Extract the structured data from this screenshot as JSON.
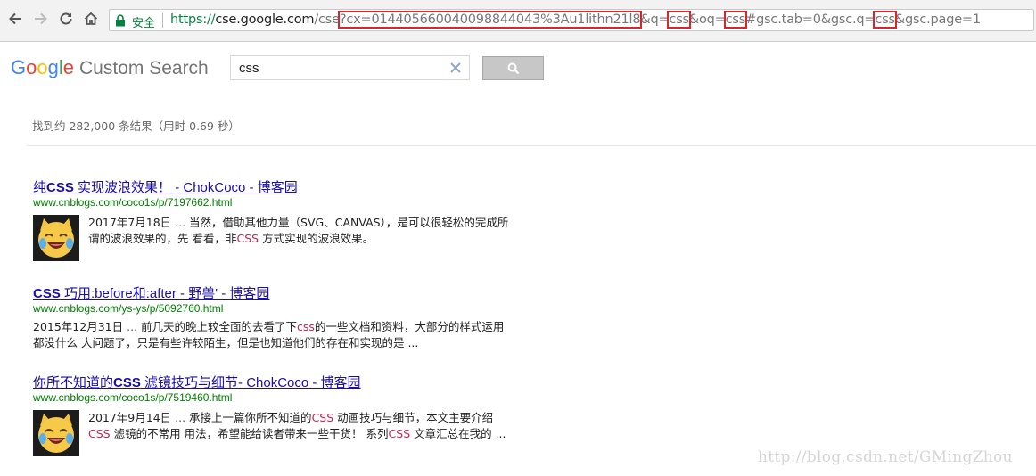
{
  "browser": {
    "secure_label": "安全",
    "url_parts": {
      "scheme": "https://",
      "host": "cse.google.com",
      "path": "/cse",
      "cx": "?cx=014405660040098844043%3Au1lithn21l8",
      "q_prefix": "&q=",
      "q_value": "css",
      "oq_prefix": "&oq=",
      "oq_value": "css",
      "hash_prefix": "#gsc.tab=0&gsc.q=",
      "gscq_value": "css",
      "tail": "&gsc.page=1"
    }
  },
  "header": {
    "logo_letters": [
      "G",
      "o",
      "o",
      "g",
      "l",
      "e"
    ],
    "logo_suffix": "Custom Search"
  },
  "search": {
    "query": "css",
    "clear_icon": "close-icon",
    "button_icon": "search-icon"
  },
  "stats": {
    "result_count_text": "找到约 282,000 条结果（用时 0.69 秒）"
  },
  "results": [
    {
      "title_pre": "纯",
      "title_kw": "CSS",
      "title_post": " 实现波浪效果！ - ChokCoco - 博客园",
      "url": "www.cnblogs.com/coco1s/p/7197662.html",
      "has_thumb": true,
      "date": "2017年7月18日",
      "ellipsis": " ... ",
      "snippet_a": "当然，借助其他力量（SVG、CANVAS），是可以很轻松的完成所谓的波浪效果的，先 看看，非",
      "snippet_kw": "CSS",
      "snippet_b": " 方式实现的波浪效果。"
    },
    {
      "title_pre": "",
      "title_kw": "CSS",
      "title_post": " 巧用:before和:after - 野兽' - 博客园",
      "url": "www.cnblogs.com/ys-ys/p/5092760.html",
      "has_thumb": false,
      "date": "2015年12月31日",
      "ellipsis": " ... ",
      "snippet_a": "前几天的晚上较全面的去看了下",
      "snippet_kw": "css",
      "snippet_b": "的一些文档和资料，大部分的样式运用都没什么 大问题了，只是有些许较陌生，但是也知道他们的存在和实现的是 ..."
    },
    {
      "title_pre": "你所不知道的",
      "title_kw": "CSS",
      "title_post": " 滤镜技巧与细节- ChokCoco - 博客园",
      "url": "www.cnblogs.com/coco1s/p/7519460.html",
      "has_thumb": true,
      "date": "2017年9月14日",
      "ellipsis": " ... ",
      "snippet_a": "承接上一篇你所不知道的",
      "snippet_kw": "CSS",
      "snippet_b": " 动画技巧与细节，本文主要介绍",
      "snippet_kw2": "CSS",
      "snippet_c": " 滤镜的不常用 用法，希望能给读者带来一些干货！ 系列",
      "snippet_kw3": "CSS",
      "snippet_d": " 文章汇总在我的 ..."
    }
  ],
  "watermark": "http://blog.csdn.net/GMingZhou",
  "colors": {
    "link": "#1a0dab",
    "url_green": "#008000",
    "keyword": "#c7254e",
    "highlight_box": "#d9262c"
  }
}
